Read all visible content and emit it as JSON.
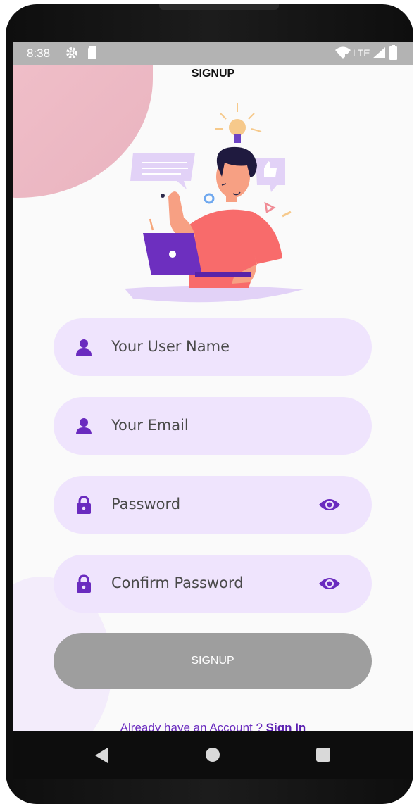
{
  "status_bar": {
    "time": "8:38",
    "network": "LTE",
    "icons": [
      "gear-icon",
      "sd-card-icon",
      "wifi-icon",
      "signal-icon",
      "battery-icon"
    ]
  },
  "page": {
    "title": "SIGNUP"
  },
  "fields": [
    {
      "placeholder": "Your User Name",
      "icon": "person-icon"
    },
    {
      "placeholder": "Your Email",
      "icon": "person-icon"
    },
    {
      "placeholder": "Password",
      "icon": "lock-icon",
      "toggle_icon": "eye-icon"
    },
    {
      "placeholder": "Confirm Password",
      "icon": "lock-icon",
      "toggle_icon": "eye-icon"
    }
  ],
  "signup_button": {
    "label": "SIGNUP"
  },
  "footer": {
    "prompt": "Already have an Account ? ",
    "link": "Sign In"
  },
  "colors": {
    "accent": "#6a2bbf",
    "field_bg": "#efe4fd",
    "button_disabled": "#9e9e9e",
    "status_bar": "#b3b3b3",
    "blob_pink": "#efbcc7"
  },
  "nav_bar": {
    "icons": [
      "back-icon",
      "home-icon",
      "recents-icon"
    ]
  }
}
